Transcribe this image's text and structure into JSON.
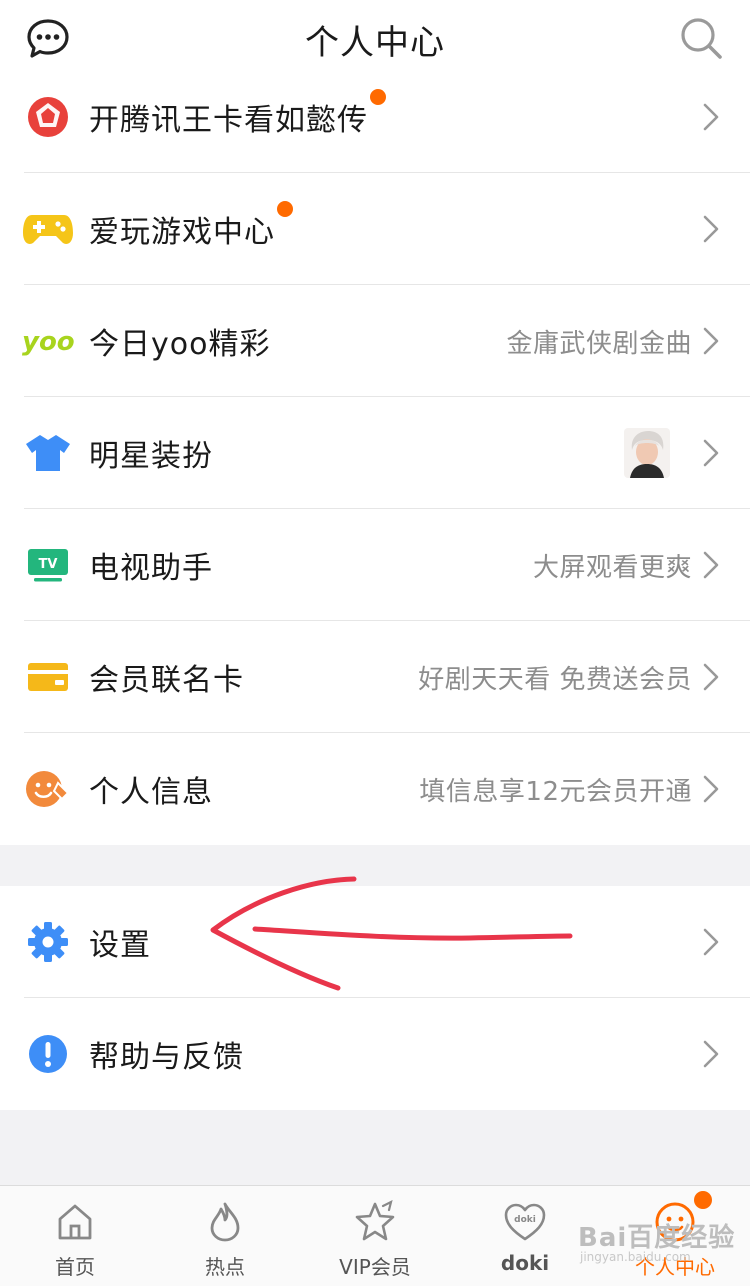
{
  "header": {
    "title": "个人中心",
    "left_icon": "message-bubble-icon",
    "right_icon": "search-icon"
  },
  "menu": [
    {
      "label": "开腾讯王卡看如懿传",
      "hint": "",
      "icon": "tencent-card-icon",
      "dot": true
    },
    {
      "label": "爱玩游戏中心",
      "hint": "",
      "icon": "gamepad-icon",
      "dot": true
    },
    {
      "label": "今日yoo精彩",
      "hint": "金庸武侠剧金曲",
      "icon": "yoo-logo-icon",
      "dot": false
    },
    {
      "label": "明星装扮",
      "hint": "",
      "icon": "tshirt-icon",
      "dot": false,
      "thumb": "star-avatar"
    },
    {
      "label": "电视助手",
      "hint": "大屏观看更爽",
      "icon": "tv-icon",
      "dot": false
    },
    {
      "label": "会员联名卡",
      "hint": "好剧天天看 免费送会员",
      "icon": "card-icon",
      "dot": false
    },
    {
      "label": "个人信息",
      "hint": "填信息享12元会员开通",
      "icon": "profile-edit-icon",
      "dot": false
    }
  ],
  "menu2": [
    {
      "label": "设置",
      "icon": "gear-icon"
    },
    {
      "label": "帮助与反馈",
      "icon": "help-icon"
    }
  ],
  "tabs": [
    {
      "label": "首页",
      "icon": "home-icon"
    },
    {
      "label": "热点",
      "icon": "flame-icon"
    },
    {
      "label": "VIP会员",
      "icon": "vip-star-icon"
    },
    {
      "label": "doki",
      "icon": "doki-heart-icon"
    },
    {
      "label": "个人中心",
      "icon": "profile-face-icon",
      "active": true
    }
  ],
  "watermark": {
    "text": "Bai百度经验",
    "sub": "jingyan.baidu.com"
  },
  "colors": {
    "accent": "#ff6a00",
    "annotation": "#e8354a"
  }
}
